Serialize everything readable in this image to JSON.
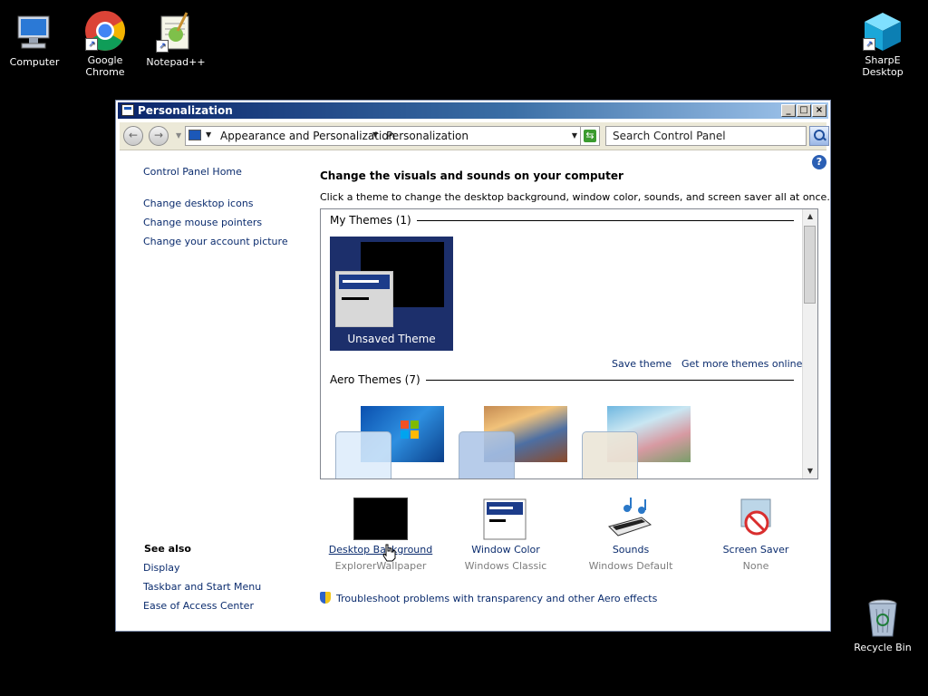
{
  "desktop": {
    "icons": [
      {
        "label": "Computer"
      },
      {
        "label": "Google Chrome"
      },
      {
        "label": "Notepad++"
      },
      {
        "label": "SharpE Desktop"
      },
      {
        "label": "Recycle Bin"
      }
    ]
  },
  "window": {
    "title": "Personalization",
    "controls": {
      "minimize": "_",
      "maximize": "□",
      "close": "×"
    }
  },
  "address_bar": {
    "breadcrumbs": [
      "Appearance and Personalization",
      "Personalization"
    ],
    "search_placeholder": "Search Control Panel"
  },
  "left_pane": {
    "home": "Control Panel Home",
    "tasks": [
      "Change desktop icons",
      "Change mouse pointers",
      "Change your account picture"
    ],
    "see_also_title": "See also",
    "see_also": [
      "Display",
      "Taskbar and Start Menu",
      "Ease of Access Center"
    ]
  },
  "main": {
    "heading": "Change the visuals and sounds on your computer",
    "description": "Click a theme to change the desktop background, window color, sounds, and screen saver all at once.",
    "my_themes_header": "My Themes (1)",
    "unsaved_theme": "Unsaved Theme",
    "save_theme": "Save theme",
    "get_more_themes": "Get more themes online",
    "aero_themes_header": "Aero Themes (7)"
  },
  "settings": [
    {
      "name": "Desktop Background",
      "value": "ExplorerWallpaper"
    },
    {
      "name": "Window Color",
      "value": "Windows Classic"
    },
    {
      "name": "Sounds",
      "value": "Windows Default"
    },
    {
      "name": "Screen Saver",
      "value": "None"
    }
  ],
  "troubleshoot_link": "Troubleshoot problems with transparency and other Aero effects",
  "colors": {
    "title_start": "#0a246a",
    "title_end": "#a6caf0",
    "link": "#0b2c6e",
    "theme_tile": "#1c2f6b"
  }
}
